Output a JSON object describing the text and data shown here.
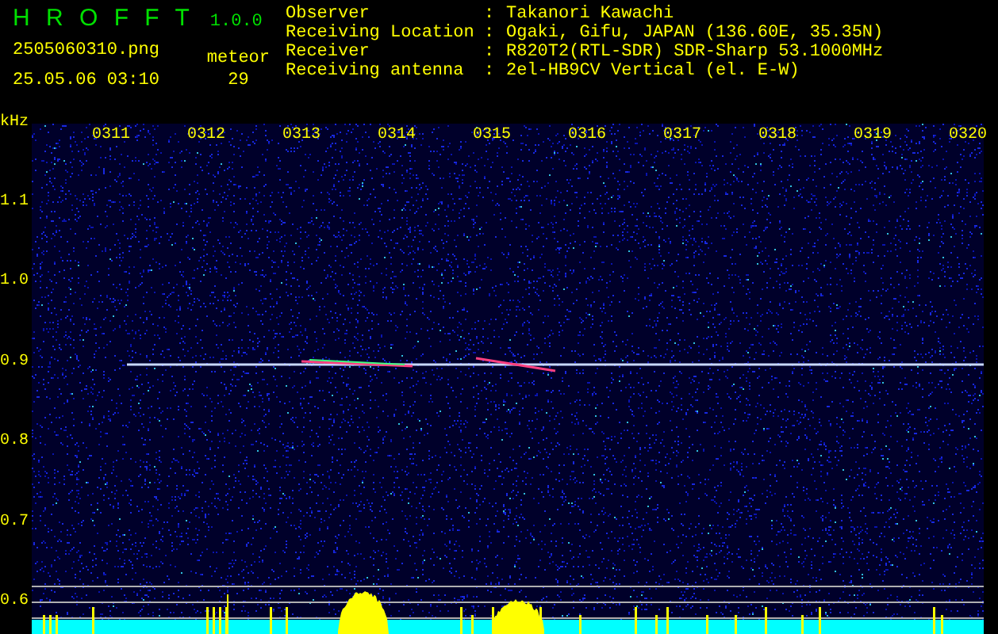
{
  "app": {
    "name": "H R O F F T",
    "version": "1.0.0"
  },
  "file": "2505060310.png",
  "datetime": "25.05.06 03:10",
  "meteor": {
    "label": "meteor",
    "count": "29"
  },
  "info": [
    {
      "label": "Observer",
      "separator": ":",
      "value": "Takanori Kawachi"
    },
    {
      "label": "Receiving Location",
      "separator": ":",
      "value": "Ogaki, Gifu, JAPAN (136.60E, 35.35N)"
    },
    {
      "label": "Receiver",
      "separator": ":",
      "value": "R820T2(RTL-SDR) SDR-Sharp 53.1000MHz"
    },
    {
      "label": "Receiving antenna",
      "separator": ":",
      "value": "2el-HB9CV Vertical (el. E-W)"
    }
  ],
  "y_axis": {
    "unit": "kHz",
    "ticks": [
      "1.1",
      "1.0",
      "0.9",
      "0.8",
      "0.7",
      "0.6"
    ]
  },
  "x_axis": {
    "ticks": [
      "0311",
      "0312",
      "0313",
      "0314",
      "0315",
      "0316",
      "0317",
      "0318",
      "0319",
      "0320"
    ]
  }
}
